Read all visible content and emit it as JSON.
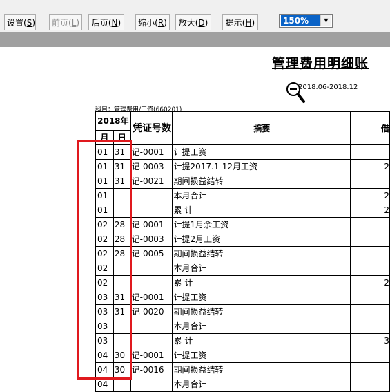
{
  "toolbar": {
    "setup": "设置(",
    "setup_key": "S",
    "prev": "前页(",
    "prev_key": "L",
    "next": "后页(",
    "next_key": "N",
    "zoom_out": "缩小(",
    "zoom_out_key": "R",
    "zoom_in": "放大(",
    "zoom_in_key": "D",
    "hint": "提示(",
    "hint_key": "H",
    "close_paren": ")",
    "zoom_value": "150%"
  },
  "document": {
    "title": "管理费用明细账",
    "period": "2018.06-2018.12",
    "subject": "科目：管理费用/工资(660201)"
  },
  "table": {
    "year_header": "2018年",
    "month_header": "月",
    "day_header": "日",
    "voucher_header": "凭证号数",
    "summary_header": "摘要",
    "extra_header": "借",
    "rows": [
      {
        "month": "01",
        "day": "31",
        "voucher": "记-0001",
        "summary": "计提工资",
        "amount": ""
      },
      {
        "month": "01",
        "day": "31",
        "voucher": "记-0003",
        "summary": "计提2017.1-12月工资",
        "amount": "2"
      },
      {
        "month": "01",
        "day": "31",
        "voucher": "记-0021",
        "summary": "期间损益结转",
        "amount": ""
      },
      {
        "month": "01",
        "day": "",
        "voucher": "",
        "summary": "本月合计",
        "amount": "2"
      },
      {
        "month": "01",
        "day": "",
        "voucher": "",
        "summary": "累    计",
        "amount": "2"
      },
      {
        "month": "02",
        "day": "28",
        "voucher": "记-0001",
        "summary": "计提1月余工资",
        "amount": ""
      },
      {
        "month": "02",
        "day": "28",
        "voucher": "记-0003",
        "summary": "计提2月工资",
        "amount": ""
      },
      {
        "month": "02",
        "day": "28",
        "voucher": "记-0005",
        "summary": "期间损益结转",
        "amount": ""
      },
      {
        "month": "02",
        "day": "",
        "voucher": "",
        "summary": "本月合计",
        "amount": ""
      },
      {
        "month": "02",
        "day": "",
        "voucher": "",
        "summary": "累    计",
        "amount": "2"
      },
      {
        "month": "03",
        "day": "31",
        "voucher": "记-0001",
        "summary": "计提工资",
        "amount": ""
      },
      {
        "month": "03",
        "day": "31",
        "voucher": "记-0020",
        "summary": "期间损益结转",
        "amount": ""
      },
      {
        "month": "03",
        "day": "",
        "voucher": "",
        "summary": "本月合计",
        "amount": ""
      },
      {
        "month": "03",
        "day": "",
        "voucher": "",
        "summary": "累    计",
        "amount": "3"
      },
      {
        "month": "04",
        "day": "30",
        "voucher": "记-0001",
        "summary": "计提工资",
        "amount": ""
      },
      {
        "month": "04",
        "day": "30",
        "voucher": "记-0016",
        "summary": "期间损益结转",
        "amount": ""
      },
      {
        "month": "04",
        "day": "",
        "voucher": "",
        "summary": "本月合计",
        "amount": ""
      }
    ]
  },
  "colors": {
    "highlight_box": "#e0191e",
    "zoom_selected": "#0a63c7",
    "toolbar_bg": "#f0f0f0",
    "band": "#a0a0a0"
  }
}
